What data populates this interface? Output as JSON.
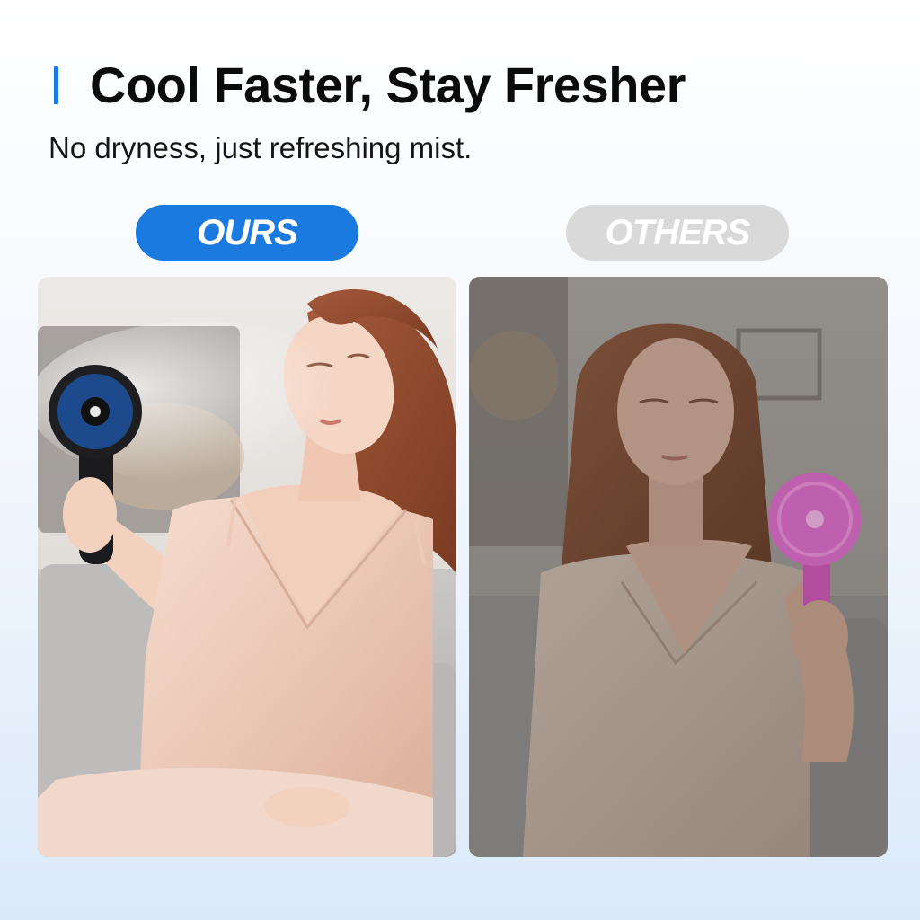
{
  "header": {
    "title": "Cool Faster, Stay Fresher",
    "subtitle": "No dryness, just refreshing mist."
  },
  "labels": {
    "ours": "OURS",
    "others": "OTHERS"
  },
  "colors": {
    "accent": "#1a7ae0",
    "others_pill": "#d9d9d9",
    "title_text": "#0b0b0b"
  },
  "images": {
    "left": "woman-with-black-mist-fan",
    "right": "woman-with-pink-fan"
  }
}
